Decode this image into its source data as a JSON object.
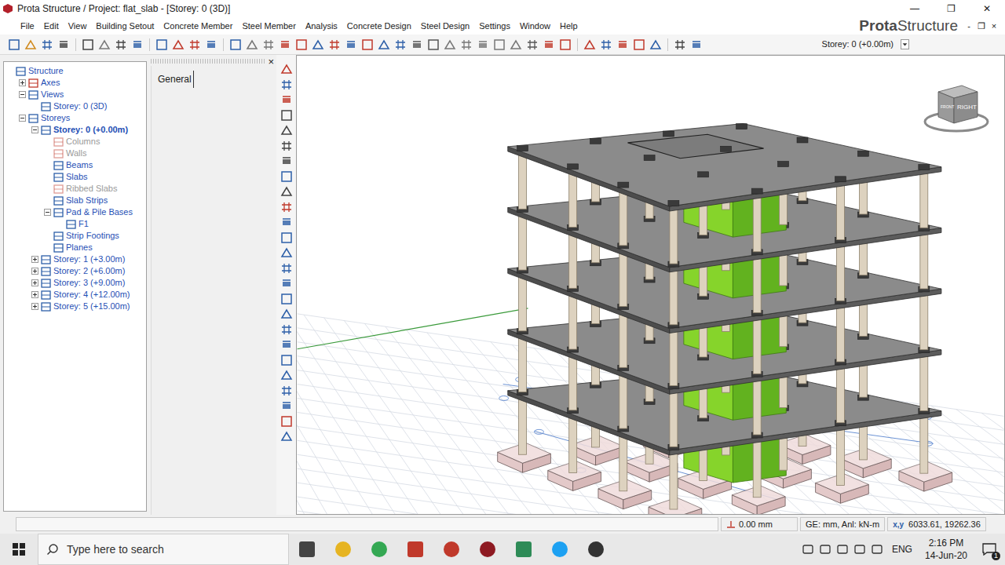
{
  "window": {
    "title": "Prota Structure / Project: flat_slab - [Storey: 0 (3D)]",
    "controls": [
      "—",
      "❐",
      "✕"
    ]
  },
  "menu": {
    "items": [
      "File",
      "Edit",
      "View",
      "Building Setout",
      "Concrete Member",
      "Steel Member",
      "Analysis",
      "Concrete Design",
      "Steel Design",
      "Settings",
      "Window",
      "Help"
    ],
    "logo": {
      "bold": "Prota",
      "light": "Structure"
    },
    "controls": [
      "-",
      "❐",
      "×"
    ]
  },
  "toolbar": {
    "storey_select": "Storey: 0 (+0.00m)"
  },
  "tree": [
    {
      "label": "Structure",
      "level": 0,
      "has_children": false,
      "expanded": false,
      "disabled": false,
      "selected": false
    },
    {
      "label": "Axes",
      "level": 1,
      "has_children": true,
      "expanded": false,
      "disabled": false,
      "selected": false
    },
    {
      "label": "Views",
      "level": 1,
      "has_children": true,
      "expanded": true,
      "disabled": false,
      "selected": false
    },
    {
      "label": "Storey: 0 (3D)",
      "level": 2,
      "has_children": false,
      "expanded": false,
      "disabled": false,
      "selected": false
    },
    {
      "label": "Storeys",
      "level": 1,
      "has_children": true,
      "expanded": true,
      "disabled": false,
      "selected": false
    },
    {
      "label": "Storey: 0 (+0.00m)",
      "level": 2,
      "has_children": true,
      "expanded": true,
      "disabled": false,
      "selected": true
    },
    {
      "label": "Columns",
      "level": 3,
      "has_children": false,
      "expanded": false,
      "disabled": true,
      "selected": false
    },
    {
      "label": "Walls",
      "level": 3,
      "has_children": false,
      "expanded": false,
      "disabled": true,
      "selected": false
    },
    {
      "label": "Beams",
      "level": 3,
      "has_children": false,
      "expanded": false,
      "disabled": false,
      "selected": false
    },
    {
      "label": "Slabs",
      "level": 3,
      "has_children": false,
      "expanded": false,
      "disabled": false,
      "selected": false
    },
    {
      "label": "Ribbed Slabs",
      "level": 3,
      "has_children": false,
      "expanded": false,
      "disabled": true,
      "selected": false
    },
    {
      "label": "Slab Strips",
      "level": 3,
      "has_children": false,
      "expanded": false,
      "disabled": false,
      "selected": false
    },
    {
      "label": "Pad & Pile Bases",
      "level": 3,
      "has_children": true,
      "expanded": true,
      "disabled": false,
      "selected": false
    },
    {
      "label": "F1",
      "level": 4,
      "has_children": false,
      "expanded": false,
      "disabled": false,
      "selected": false
    },
    {
      "label": "Strip Footings",
      "level": 3,
      "has_children": false,
      "expanded": false,
      "disabled": false,
      "selected": false
    },
    {
      "label": "Planes",
      "level": 3,
      "has_children": false,
      "expanded": false,
      "disabled": false,
      "selected": false
    },
    {
      "label": "Storey: 1 (+3.00m)",
      "level": 2,
      "has_children": true,
      "expanded": false,
      "disabled": false,
      "selected": false
    },
    {
      "label": "Storey: 2 (+6.00m)",
      "level": 2,
      "has_children": true,
      "expanded": false,
      "disabled": false,
      "selected": false
    },
    {
      "label": "Storey: 3 (+9.00m)",
      "level": 2,
      "has_children": true,
      "expanded": false,
      "disabled": false,
      "selected": false
    },
    {
      "label": "Storey: 4 (+12.00m)",
      "level": 2,
      "has_children": true,
      "expanded": false,
      "disabled": false,
      "selected": false
    },
    {
      "label": "Storey: 5 (+15.00m)",
      "level": 2,
      "has_children": true,
      "expanded": false,
      "disabled": false,
      "selected": false
    }
  ],
  "general_panel": {
    "tab": "General",
    "close": "×"
  },
  "viewcube": {
    "face": "RIGHT",
    "side_face": "FRONT"
  },
  "status_bar": {
    "elevation": "0.00 mm",
    "units": "GE: mm, Anl: kN-m",
    "coords_label": "x,y",
    "coords": "6033.61, 19262.36"
  },
  "taskbar": {
    "search_placeholder": "Type here to search",
    "language": "ENG",
    "time": "2:16 PM",
    "date": "14-Jun-20",
    "notifications": "1"
  }
}
